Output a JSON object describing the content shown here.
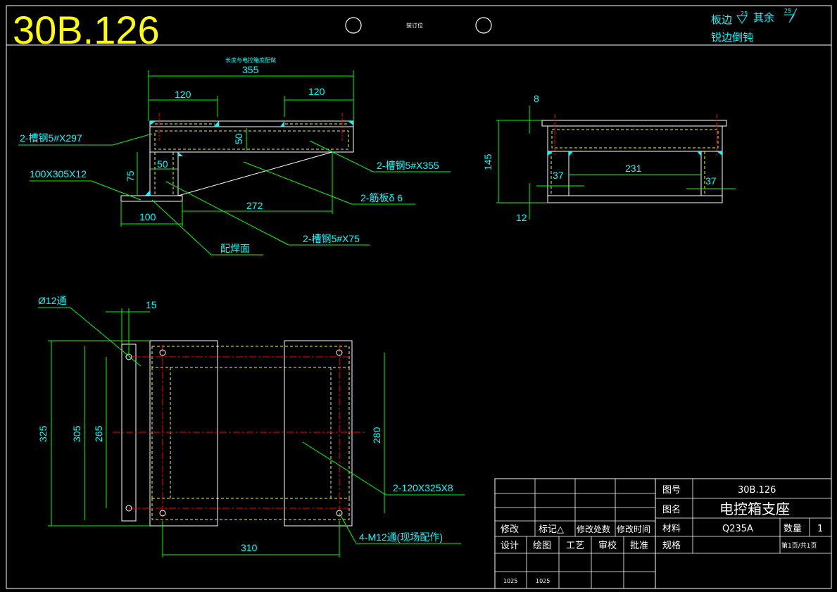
{
  "header": {
    "drawing_code": "30B.126",
    "binding_label": "装订位",
    "surface_note_left": "板边",
    "surface_note_left_value": "25",
    "surface_note_mid": "其余",
    "surface_note_right_value": "25",
    "edge_note": "锐边倒钝"
  },
  "front_view": {
    "top_note": "长度与电控箱度配做",
    "dims": {
      "overall": "355",
      "left_pad": "120",
      "right_pad": "120",
      "beam_height": "50",
      "leg_height": "75",
      "leg_width": "50",
      "base_width": "100",
      "rib_span": "272"
    },
    "callouts": {
      "top_channel": "2-槽钢5#X297",
      "base_plate": "100X305X12",
      "long_channel": "2-槽钢5#X355",
      "rib": "2-筋板δ 6",
      "leg_channel": "2-槽钢5#X75",
      "weld_note": "配焊面"
    }
  },
  "side_view": {
    "dims": {
      "top_plate": "8",
      "height": "145",
      "left_leg": "37",
      "span": "231",
      "right_leg": "37",
      "base": "12"
    }
  },
  "plan_view": {
    "dims": {
      "hole_callout": "Ø12通",
      "hole_offset": "15",
      "overall_len": "325",
      "hole_span_outer": "305",
      "hole_span_inner": "265",
      "right_span": "280",
      "bottom_span": "310"
    },
    "callouts": {
      "plate": "2-120X325X8",
      "bolt_holes": "4-M12通(现场配作)"
    }
  },
  "title_block": {
    "drawing_no_label": "图号",
    "drawing_no": "30B.126",
    "name_label": "图名",
    "name": "电控箱支座",
    "material_label": "材料",
    "material": "Q235A",
    "qty_label": "数量",
    "qty": "1",
    "spec_label": "规格",
    "page": "第1页/共1页",
    "rev_headers": [
      "修改",
      "标记△",
      "修改处数",
      "修改时间"
    ],
    "sign_headers": [
      "设计",
      "绘图",
      "工艺",
      "审校",
      "批准"
    ],
    "sign_values": [
      "1025",
      "1025"
    ]
  }
}
